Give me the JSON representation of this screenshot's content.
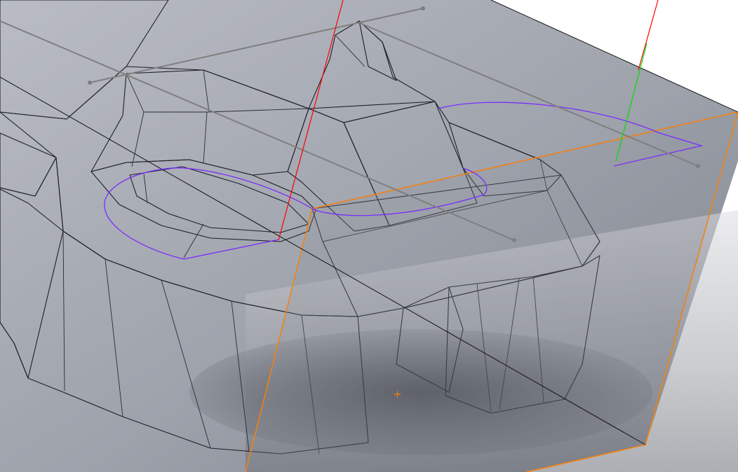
{
  "viewport": {
    "background": "#ffffff",
    "model_face_color": "#9a9fb2",
    "model_edge_color": "#1e2028",
    "plane_color": "#8e929c",
    "plane_edge_color": "#ff7f00",
    "sketch_color": "#7a2cff",
    "axis_x_color": "#ff0000",
    "axis_y_color": "#00dd00",
    "construction_line_color": "#7f7f7f",
    "origin_marker": "plus",
    "origin_marker_color": "#ff7f00"
  }
}
